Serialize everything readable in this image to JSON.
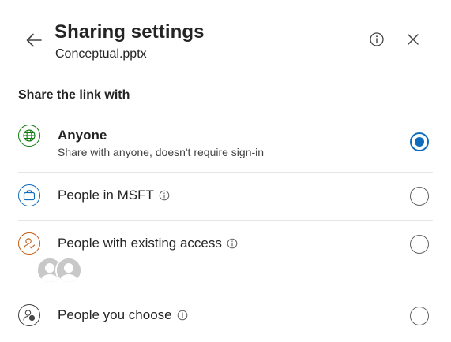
{
  "header": {
    "title": "Sharing settings",
    "file_name": "Conceptual.pptx"
  },
  "section_label": "Share the link with",
  "options": [
    {
      "label": "Anyone",
      "description": "Share with anyone, doesn't require sign-in",
      "icon": "globe-icon",
      "selected": true
    },
    {
      "label": "People in MSFT",
      "icon": "briefcase-icon",
      "has_info": true,
      "selected": false
    },
    {
      "label": "People with existing access",
      "icon": "person-check-icon",
      "has_info": true,
      "selected": false
    },
    {
      "label": "People you choose",
      "icon": "person-add-icon",
      "has_info": true,
      "selected": false
    }
  ],
  "colors": {
    "accent": "#0f6cbd",
    "globe": "#107c10",
    "briefcase": "#0f6cbd",
    "person_existing": "#c55a11"
  }
}
